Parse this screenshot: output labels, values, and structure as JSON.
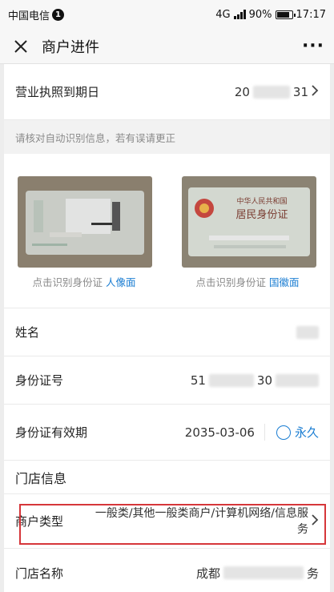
{
  "status_bar": {
    "carrier": "中国电信",
    "notification_count": "1",
    "network": "4G",
    "battery": "90%",
    "battery_level": 0.9,
    "time": "17:17"
  },
  "nav": {
    "title": "商户进件",
    "close_icon": "close-icon",
    "more_icon": "more-icon"
  },
  "business_license_expiry": {
    "label": "营业执照到期日",
    "value_visible_start": "20",
    "value_visible_end": "31"
  },
  "hint": "请核对自动识别信息，若有误请更正",
  "id_cards": {
    "front": {
      "caption": "点击识别身份证",
      "side": "人像面"
    },
    "back": {
      "caption": "点击识别身份证",
      "side": "国徽面",
      "card_title_line1": "中华人民共和国",
      "card_title_line2": "居民身份证"
    }
  },
  "form": {
    "name_label": "姓名",
    "id_number_label": "身份证号",
    "id_number_visible_start": "51",
    "id_number_visible_mid": "30",
    "id_validity_label": "身份证有效期",
    "id_validity_date": "2035-03-06",
    "id_validity_forever": "永久"
  },
  "store_section": {
    "title": "门店信息",
    "merchant_type_label": "商户类型",
    "merchant_type_value": "一般类/其他一般类商户/计算机网络/信息服务",
    "store_name_label": "门店名称",
    "store_name_start": "成都",
    "store_name_end": "务"
  },
  "colors": {
    "accent": "#1a7dd2",
    "highlight": "#d6363a"
  }
}
